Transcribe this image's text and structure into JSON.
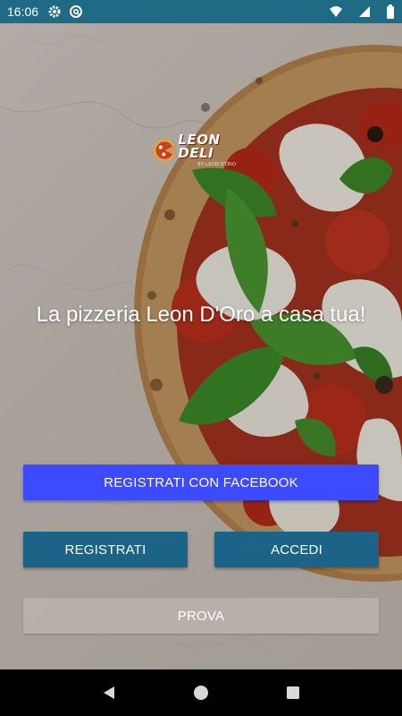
{
  "status_bar": {
    "time": "16:06",
    "left_icons": [
      "gear-icon",
      "at-sign-icon"
    ],
    "right_icons": [
      "wifi-icon",
      "signal-icon",
      "battery-icon"
    ],
    "color": "#1f6b86"
  },
  "logo": {
    "name": "LEON DELI",
    "sub": "BY LEON D'ORO"
  },
  "tagline": "La pizzeria Leon D'Oro a casa tua!",
  "buttons": {
    "facebook": "REGISTRATI CON FACEBOOK",
    "register": "REGISTRATI",
    "login": "ACCEDI",
    "try": "PROVA"
  },
  "colors": {
    "facebook": "#3d4bff",
    "primary": "#1c6487",
    "try": "#beb6af"
  },
  "nav_bar": {
    "icons": [
      "back-icon",
      "home-icon",
      "recents-icon"
    ]
  }
}
